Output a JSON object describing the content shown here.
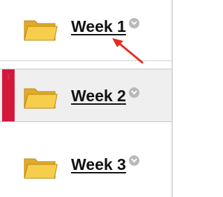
{
  "items": [
    {
      "label": "Week 1"
    },
    {
      "label": "Week 2"
    },
    {
      "label": "Week 3"
    }
  ],
  "icons": {
    "folder": "folder-icon",
    "menu": "chevron-down-icon",
    "drag": "drag-handle"
  },
  "colors": {
    "folder_fill": "#f3c43b",
    "folder_edge": "#b88a16",
    "highlight": "#d3183a",
    "arrow": "#e52b22",
    "row_highlight_bg": "#efefef"
  }
}
